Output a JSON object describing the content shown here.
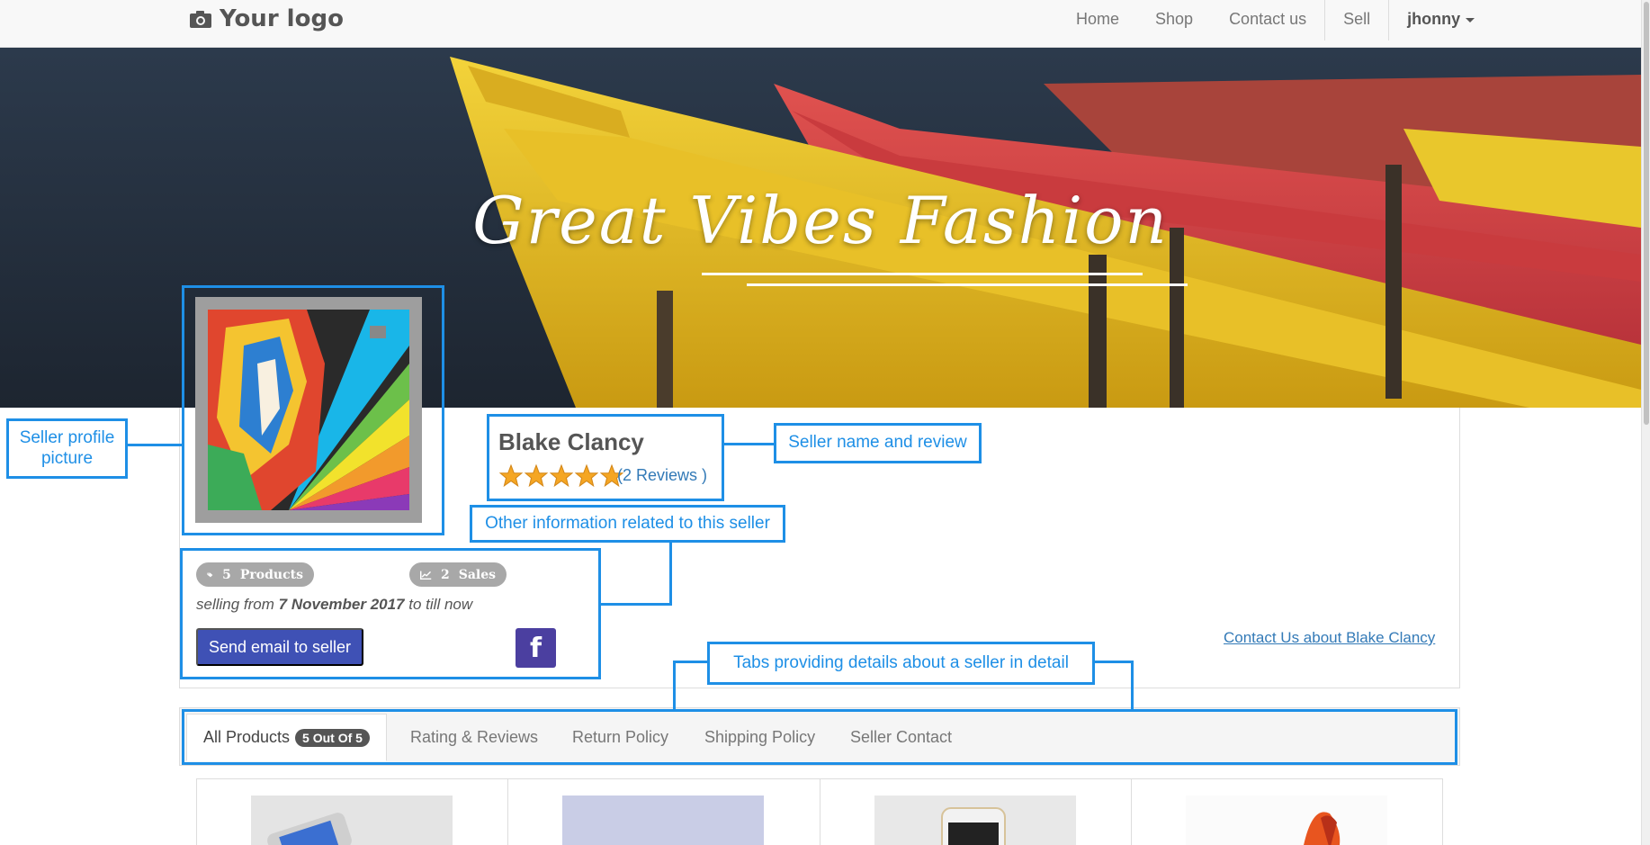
{
  "navbar": {
    "logo_text": "Your logo",
    "links": [
      "Home",
      "Shop",
      "Contact us",
      "Sell"
    ],
    "user": "jhonny"
  },
  "hero": {
    "title": "Great Vibes Fashion"
  },
  "seller": {
    "name": "Blake Clancy",
    "rating_stars": 5,
    "reviews_link": "(2 Reviews )",
    "products_count": "5",
    "products_label": "Products",
    "sales_count": "2",
    "sales_label": "Sales",
    "selling_prefix": "selling from",
    "selling_date": "7 November 2017",
    "selling_suffix": "to till now",
    "send_email_label": "Send email to seller",
    "facebook_glyph": "f",
    "contact_link": "Contact Us about Blake Clancy"
  },
  "tabs": [
    {
      "label": "All Products",
      "badge": "5 Out Of 5",
      "active": true
    },
    {
      "label": "Rating & Reviews"
    },
    {
      "label": "Return Policy"
    },
    {
      "label": "Shipping Policy"
    },
    {
      "label": "Seller Contact"
    }
  ],
  "annotations": {
    "profile_picture": "Seller profile picture",
    "name_review": "Seller name and review",
    "other_info": "Other information related to this seller",
    "tabs_info": "Tabs providing details about a seller in detail"
  },
  "colors": {
    "annotation": "#1e8fe6",
    "link": "#337ab7",
    "send_button": "#3f51b5",
    "facebook": "#4b3fa0",
    "star": "#f5a623"
  }
}
